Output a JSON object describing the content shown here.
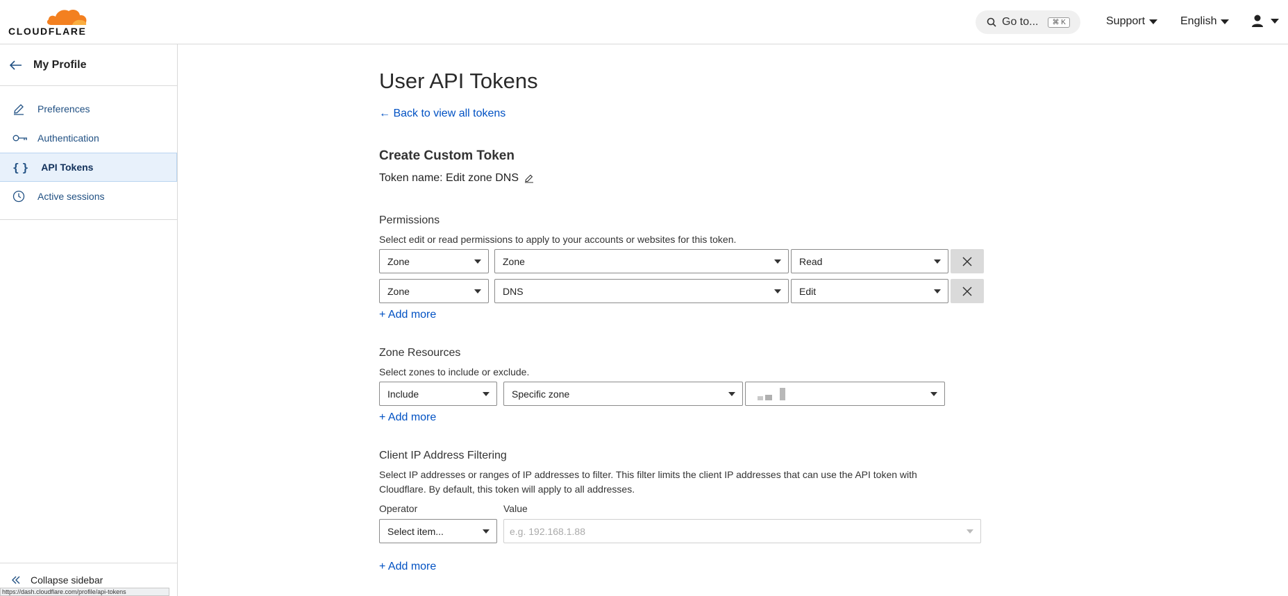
{
  "brand": {
    "logo_text": "CLOUDFLARE",
    "accent": "#f38020",
    "link": "#0051c3"
  },
  "topbar": {
    "search_label": "Go to...",
    "search_shortcut": "⌘ K",
    "support": "Support",
    "language": "English",
    "user_icon": "user-icon"
  },
  "sidebar": {
    "title": "My Profile",
    "items": [
      {
        "label": "Preferences",
        "icon": "pencil-icon"
      },
      {
        "label": "Authentication",
        "icon": "key-icon"
      },
      {
        "label": "API Tokens",
        "icon": "braces-icon",
        "active": true
      },
      {
        "label": "Active sessions",
        "icon": "clock-icon"
      }
    ],
    "collapse_label": "Collapse sidebar",
    "status_url": "https://dash.cloudflare.com/profile/api-tokens"
  },
  "main": {
    "title": "User API Tokens",
    "back_link": "← Back to view all tokens",
    "form_title": "Create Custom Token",
    "token_name_label": "Token name: Edit zone DNS",
    "permissions": {
      "title": "Permissions",
      "description": "Select edit or read permissions to apply to your accounts or websites for this token.",
      "rows": [
        {
          "scope": "Zone",
          "resource": "Zone",
          "access": "Read"
        },
        {
          "scope": "Zone",
          "resource": "DNS",
          "access": "Edit"
        }
      ],
      "add_more": "+ Add more"
    },
    "zone_resources": {
      "title": "Zone Resources",
      "description": "Select zones to include or exclude.",
      "include": "Include",
      "zone_type": "Specific zone",
      "add_more": "+ Add more"
    },
    "ip_filtering": {
      "title": "Client IP Address Filtering",
      "description": "Select IP addresses or ranges of IP addresses to filter. This filter limits the client IP addresses that can use the API token with Cloudflare. By default, this token will apply to all addresses.",
      "operator_label": "Operator",
      "value_label": "Value",
      "operator_placeholder": "Select item...",
      "value_placeholder": "e.g. 192.168.1.88",
      "add_more": "+ Add more"
    }
  }
}
